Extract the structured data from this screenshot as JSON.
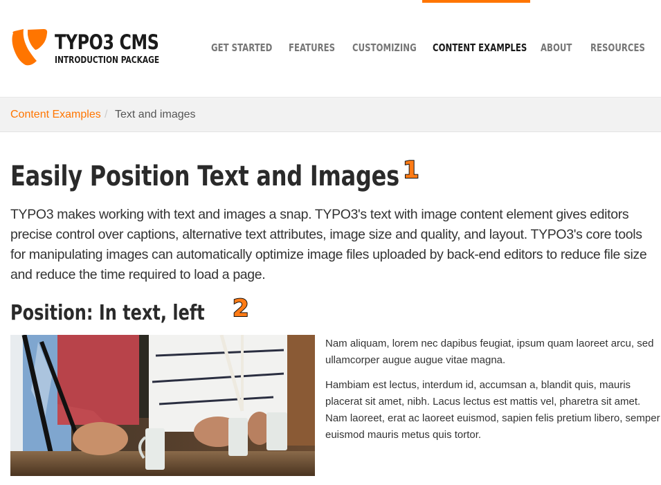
{
  "brand": {
    "title": "TYPO3 CMS",
    "subtitle": "INTRODUCTION PACKAGE",
    "logo_icon": "typo3-logo-icon",
    "accent_color": "#ff7500"
  },
  "nav": {
    "items": [
      {
        "label": "GET STARTED",
        "active": false
      },
      {
        "label": "FEATURES",
        "active": false
      },
      {
        "label": "CUSTOMIZING",
        "active": false
      },
      {
        "label": "CONTENT EXAMPLES",
        "active": true
      },
      {
        "label": "ABOUT",
        "active": false
      },
      {
        "label": "RESOURCES",
        "active": false
      }
    ]
  },
  "breadcrumb": {
    "parent": "Content Examples",
    "separator": "/",
    "current": "Text and images"
  },
  "main": {
    "title": "Easily Position Text and Images",
    "title_marker": "1",
    "intro": "TYPO3 makes working with text and images a snap. TYPO3's text with image content element gives editors precise control over captions, alternative text attributes, image size and quality, and layout. TYPO3's core tools for manipulating images can automatically optimize image files uploaded by back-end editors to reduce file size and reduce the time required to load a page.",
    "section": {
      "title": "Position: In text, left",
      "marker": "2",
      "image_alt": "People holding coffee mugs at a table",
      "paragraphs": [
        "Nam aliquam, lorem nec dapibus feugiat, ipsum quam laoreet arcu, sed ullamcorper augue augue vitae magna.",
        "Hambiam est lectus, interdum id, accumsan a, blandit quis, mauris placerat sit amet, nibh. Lacus lectus est mattis vel, pharetra sit amet. Nam laoreet, erat ac laoreet euismod, sapien felis pretium libero, semper euismod mauris metus quis tortor."
      ]
    }
  }
}
